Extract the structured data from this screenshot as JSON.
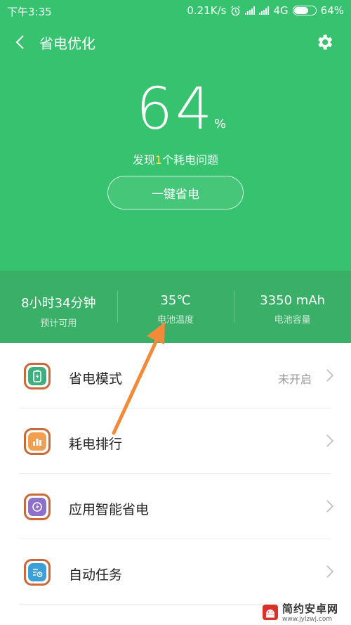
{
  "status": {
    "time": "下午3:35",
    "speed": "0.21K/s",
    "network": "4G",
    "battery": "64%",
    "battery_fraction": 0.64
  },
  "header": {
    "title": "省电优化",
    "back_icon": "chevron-left-icon",
    "settings_icon": "gear-icon"
  },
  "hero": {
    "percent": "64",
    "unit": "%",
    "issue_prefix": "发现",
    "issue_count": "1",
    "issue_suffix": "个耗电问题",
    "button": "一键省电",
    "accent": "#36c26e"
  },
  "stats": [
    {
      "value": "8小时34分钟",
      "label": "预计可用"
    },
    {
      "value": "35℃",
      "label": "电池温度"
    },
    {
      "value": "3350 mAh",
      "label": "电池容量"
    }
  ],
  "menu": [
    {
      "label": "省电模式",
      "value": "未开启",
      "icon": "battery-saver-icon",
      "color": "#3fae7e"
    },
    {
      "label": "耗电排行",
      "value": "",
      "icon": "bar-chart-icon",
      "color": "#f0a050"
    },
    {
      "label": "应用智能省电",
      "value": "",
      "icon": "app-power-icon",
      "color": "#8f6fc8"
    },
    {
      "label": "自动任务",
      "value": "",
      "icon": "auto-task-icon",
      "color": "#3ba0d8"
    }
  ],
  "watermark": {
    "name": "简约安卓网",
    "url": "www.jylzwj.com"
  }
}
